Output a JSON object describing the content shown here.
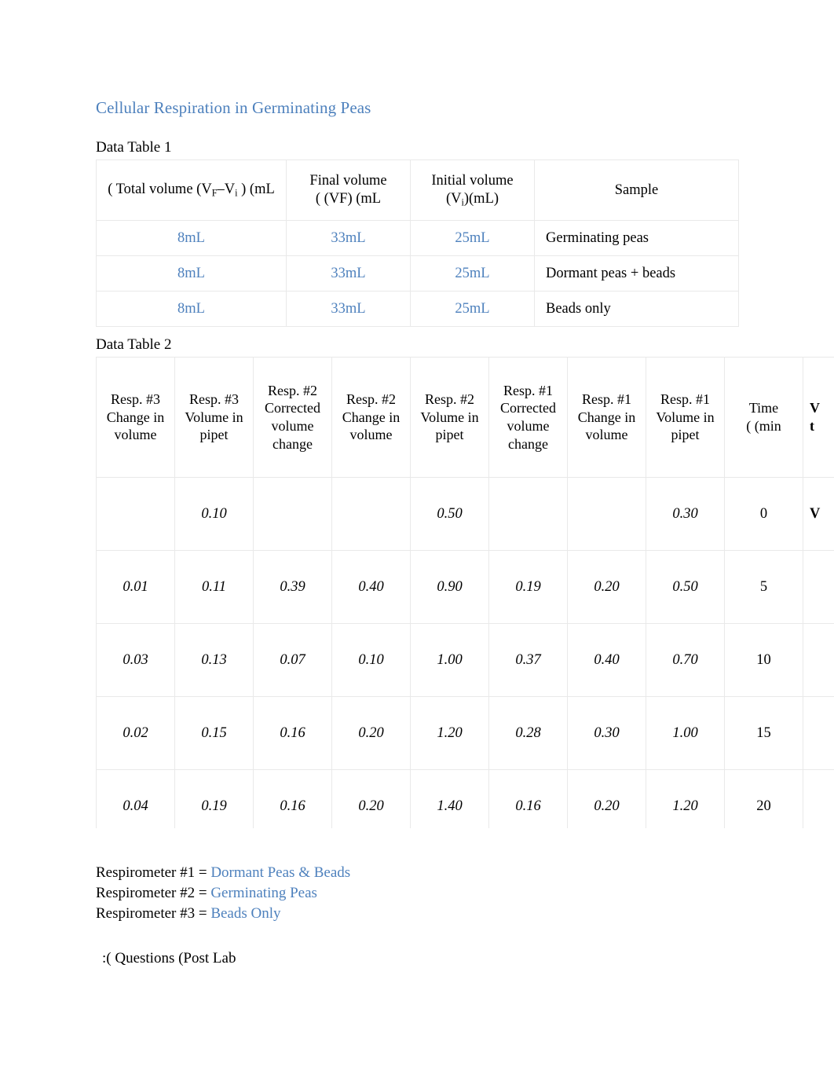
{
  "document": {
    "title": "Cellular Respiration in Germinating Peas",
    "title_color": "#4e81bd",
    "entry_color": "#4e81bd"
  },
  "table1": {
    "label": "Data Table 1",
    "headers": {
      "total_volume_prefix": "( Total volume (V",
      "total_volume_sub1": "F",
      "total_volume_mid": "–V",
      "total_volume_sub2": "i",
      "total_volume_suffix": " ) (mL",
      "final_volume_line1": "Final volume",
      "final_volume_line2": "( (VF) (mL",
      "initial_volume_line1": "Initial volume",
      "initial_volume_line2_prefix": "(V",
      "initial_volume_sub": "i",
      "initial_volume_line2_suffix": ")(mL)",
      "sample": "Sample"
    },
    "rows": [
      {
        "total": "8mL",
        "final": "33mL",
        "initial": "25mL",
        "sample": "Germinating peas"
      },
      {
        "total": "8mL",
        "final": "33mL",
        "initial": "25mL",
        "sample": "Dormant peas + beads"
      },
      {
        "total": "8mL",
        "final": "33mL",
        "initial": "25mL",
        "sample": "Beads only"
      }
    ]
  },
  "table2": {
    "label": "Data Table 2",
    "headers": [
      "Resp. #3 Change in volume",
      "Resp. #3 Volume in pipet",
      "Resp. #2 Corrected volume change",
      "Resp. #2 Change in volume",
      "Resp. #2 Volume in pipet",
      "Resp. #1 Corrected volume change",
      "Resp. #1 Change in volume",
      "Resp. #1 Volume in pipet",
      "Time ( (min",
      "V t"
    ],
    "rows": [
      {
        "r3_change": "",
        "r3_pipet": "0.10",
        "r2_corrected": "",
        "r2_change": "",
        "r2_pipet": "0.50",
        "r1_corrected": "",
        "r1_change": "",
        "r1_pipet": "0.30",
        "time": "0",
        "cut": "V"
      },
      {
        "r3_change": "0.01",
        "r3_pipet": "0.11",
        "r2_corrected": "0.39",
        "r2_change": "0.40",
        "r2_pipet": "0.90",
        "r1_corrected": "0.19",
        "r1_change": "0.20",
        "r1_pipet": "0.50",
        "time": "5",
        "cut": ""
      },
      {
        "r3_change": "0.03",
        "r3_pipet": "0.13",
        "r2_corrected": "0.07",
        "r2_change": "0.10",
        "r2_pipet": "1.00",
        "r1_corrected": "0.37",
        "r1_change": "0.40",
        "r1_pipet": "0.70",
        "time": "10",
        "cut": ""
      },
      {
        "r3_change": "0.02",
        "r3_pipet": "0.15",
        "r2_corrected": "0.16",
        "r2_change": "0.20",
        "r2_pipet": "1.20",
        "r1_corrected": "0.28",
        "r1_change": "0.30",
        "r1_pipet": "1.00",
        "time": "15",
        "cut": ""
      },
      {
        "r3_change": "0.04",
        "r3_pipet": "0.19",
        "r2_corrected": "0.16",
        "r2_change": "0.20",
        "r2_pipet": "1.40",
        "r1_corrected": "0.16",
        "r1_change": "0.20",
        "r1_pipet": "1.20",
        "time": "20",
        "cut": ""
      }
    ]
  },
  "legend": [
    {
      "label": "Respirometer #1 = ",
      "answer": "Dormant Peas & Beads"
    },
    {
      "label": "Respirometer #2 = ",
      "answer": "Germinating Peas"
    },
    {
      "label": "Respirometer #3 = ",
      "answer": "Beads Only"
    }
  ],
  "questions_heading": ":( Questions (Post Lab"
}
